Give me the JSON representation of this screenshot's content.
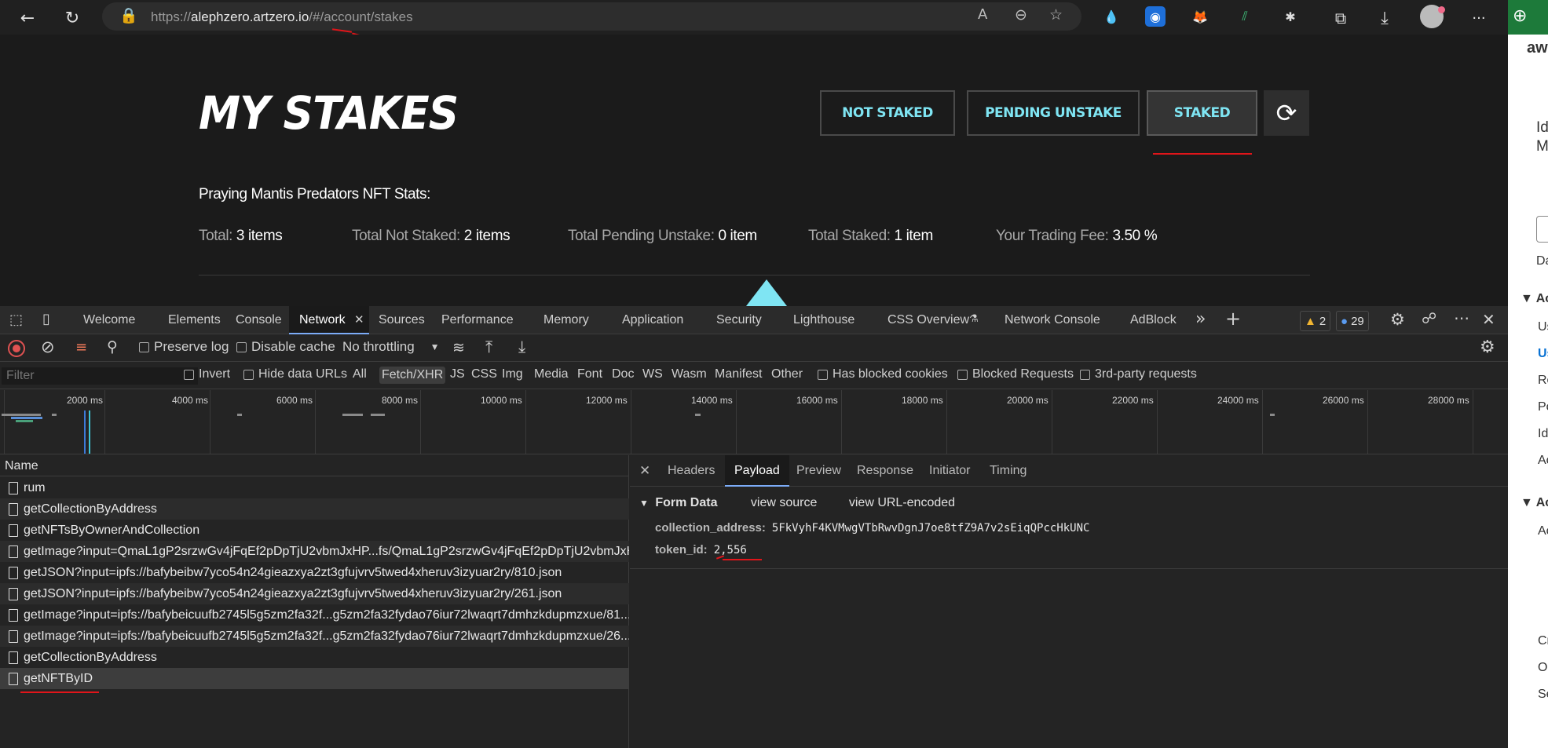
{
  "browser": {
    "url_prefix": "https://",
    "url_host": "alephzero.artzero.io",
    "url_path": "/#/account/stakes",
    "back": "←",
    "reload": "↻",
    "lock": "🔒",
    "read_aloud": "A",
    "zoom": "⊖",
    "favorites": "☆",
    "split": "⧉",
    "download": "⤓",
    "more": "···",
    "extensions": [
      "💧",
      "◉",
      "🦊",
      "⫽",
      "✱"
    ]
  },
  "page": {
    "title": "MY STAKES",
    "filters": [
      {
        "label": "NOT STAKED"
      },
      {
        "label": "PENDING UNSTAKE"
      },
      {
        "label": "STAKED"
      }
    ],
    "refresh": "⟳",
    "stats_heading": "Praying Mantis Predators NFT Stats:",
    "stats": [
      {
        "label": "Total:",
        "value": "3 items"
      },
      {
        "label": "Total Not Staked:",
        "value": "2 items"
      },
      {
        "label": "Total Pending Unstake:",
        "value": "0 item"
      },
      {
        "label": "Total Staked:",
        "value": "1 item"
      },
      {
        "label": "Your Trading Fee:",
        "value": "3.50 %"
      }
    ]
  },
  "side_panel": {
    "brand": "aws",
    "letter_top": "⊕",
    "items": [
      "Id",
      "M",
      "Da",
      "Ac",
      "Us",
      "Us",
      "Ro",
      "Po",
      "Id",
      "Ac",
      "Ac",
      "Ac",
      "Cr",
      "O",
      "Se"
    ]
  },
  "devtools": {
    "tabs": [
      "Welcome",
      "Elements",
      "Console",
      "Network",
      "Sources",
      "Performance",
      "Memory",
      "Application",
      "Security",
      "Lighthouse",
      "CSS Overview",
      "Network Console",
      "AdBlock"
    ],
    "active_tab": "Network",
    "warnings_count": "2",
    "issues_count": "29",
    "more_tabs": "»",
    "add_tab": "+",
    "toolbar": {
      "preserve_log": "Preserve log",
      "disable_cache": "Disable cache",
      "throttling": "No throttling"
    },
    "filter": {
      "placeholder": "Filter",
      "invert": "Invert",
      "hide_data_urls": "Hide data URLs",
      "types": [
        "All",
        "Fetch/XHR",
        "JS",
        "CSS",
        "Img",
        "Media",
        "Font",
        "Doc",
        "WS",
        "Wasm",
        "Manifest",
        "Other"
      ],
      "active_type": "Fetch/XHR",
      "has_blocked_cookies": "Has blocked cookies",
      "blocked_requests": "Blocked Requests",
      "third_party": "3rd-party requests"
    },
    "timeline_ticks": [
      "2000 ms",
      "4000 ms",
      "6000 ms",
      "8000 ms",
      "10000 ms",
      "12000 ms",
      "14000 ms",
      "16000 ms",
      "18000 ms",
      "20000 ms",
      "22000 ms",
      "24000 ms",
      "26000 ms",
      "28000 ms"
    ],
    "requests_header": "Name",
    "requests": [
      "rum",
      "getCollectionByAddress",
      "getNFTsByOwnerAndCollection",
      "getImage?input=QmaL1gP2srzwGv4jFqEf2pDpTjU2vbmJxHP...fs/QmaL1gP2srzwGv4jFqEf2pDpTjU2vbmJxHPz...",
      "getJSON?input=ipfs://bafybeibw7yco54n24gieazxya2zt3gfujvrv5twed4xheruv3izyuar2ry/810.json",
      "getJSON?input=ipfs://bafybeibw7yco54n24gieazxya2zt3gfujvrv5twed4xheruv3izyuar2ry/261.json",
      "getImage?input=ipfs://bafybeicuufb2745l5g5zm2fa32f...g5zm2fa32fydao76iur72lwaqrt7dmhzkdupmzxue/81...",
      "getImage?input=ipfs://bafybeicuufb2745l5g5zm2fa32f...g5zm2fa32fydao76iur72lwaqrt7dmhzkdupmzxue/26...",
      "getCollectionByAddress",
      "getNFTByID"
    ],
    "details": {
      "close": "✕",
      "tabs": [
        "Headers",
        "Payload",
        "Preview",
        "Response",
        "Initiator",
        "Timing"
      ],
      "active_tab": "Payload",
      "form_data_label": "Form Data",
      "view_source": "view source",
      "view_url_encoded": "view URL-encoded",
      "fields": [
        {
          "key": "collection_address:",
          "value": "5FkVyhF4KVMwgVTbRwvDgnJ7oe8tfZ9A7v2sEiqQPccHkUNC"
        },
        {
          "key": "token_id:",
          "value": "2,556"
        }
      ]
    }
  },
  "colors": {
    "accent": "#7fe5f3",
    "annotation": "#e0151a",
    "devtools_bg": "#242424"
  }
}
